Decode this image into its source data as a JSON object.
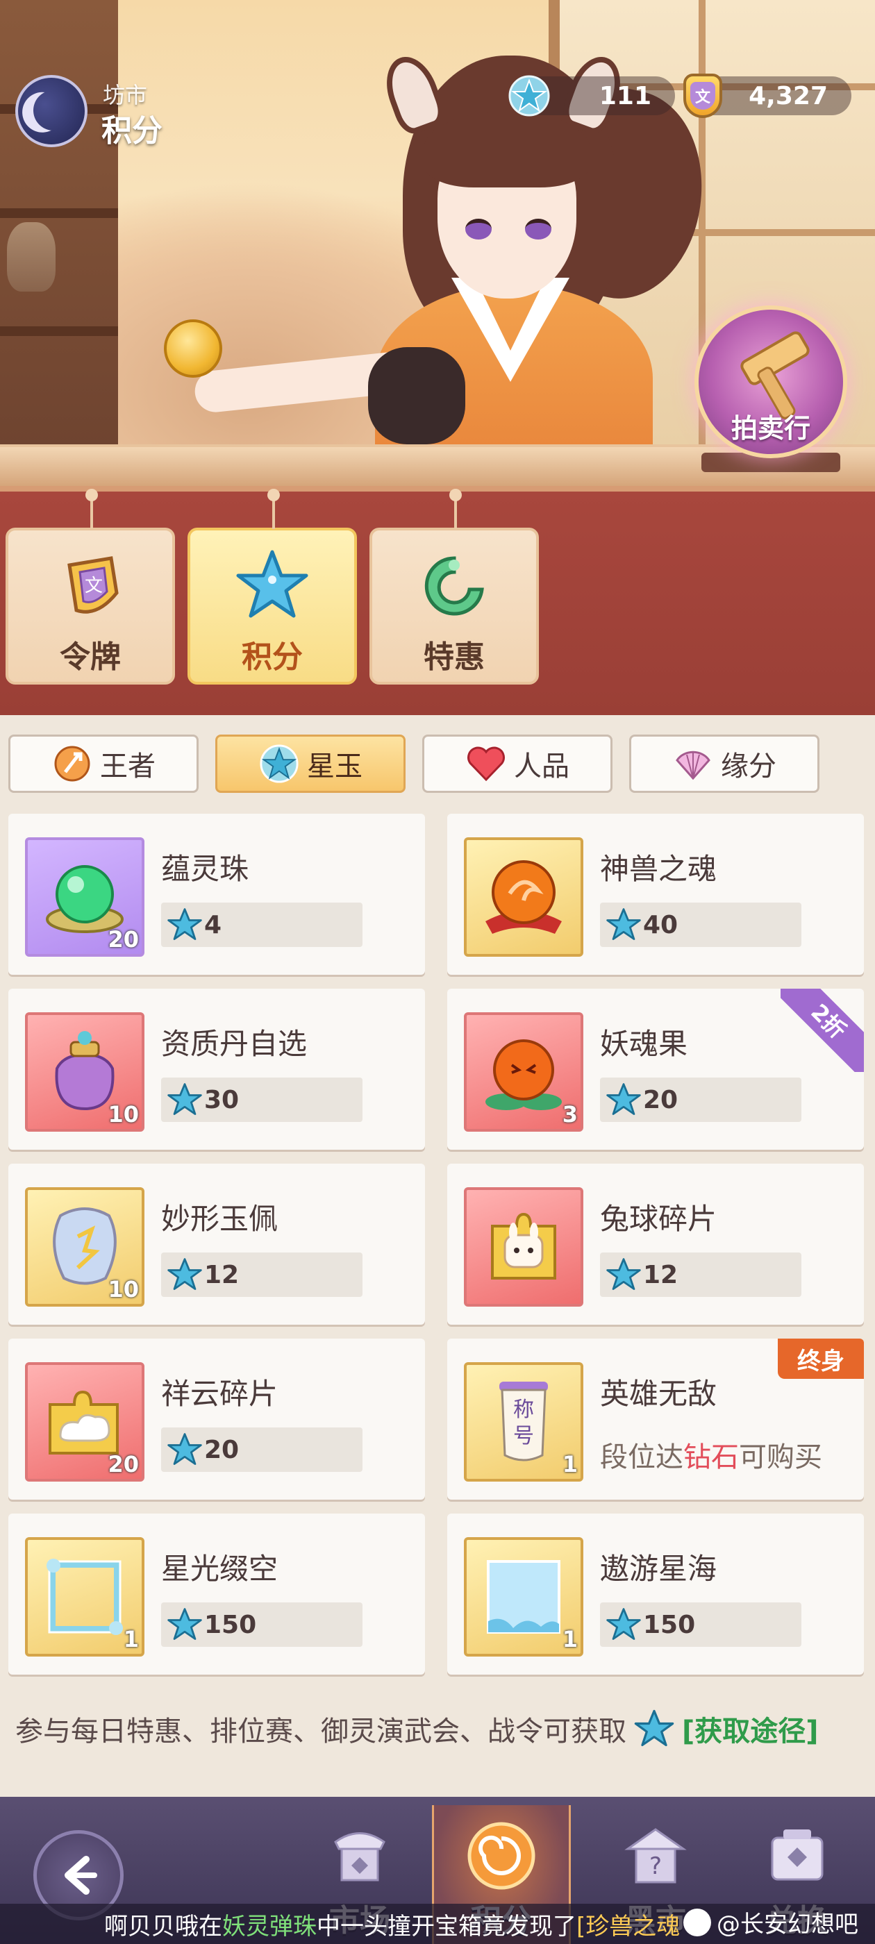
{
  "header": {
    "breadcrumb": "坊市",
    "title": "积分",
    "currencies": [
      {
        "icon": "star-jade-icon",
        "value": "111"
      },
      {
        "icon": "token-coin-icon",
        "value": "4,327"
      }
    ],
    "auction_label": "拍卖行"
  },
  "categories": [
    {
      "label": "令牌",
      "icon": "token-icon",
      "active": false
    },
    {
      "label": "积分",
      "icon": "star-icon",
      "active": true
    },
    {
      "label": "特惠",
      "icon": "jade-dragon-icon",
      "active": false
    }
  ],
  "subtabs": [
    {
      "label": "王者",
      "icon": "sword-icon",
      "active": false
    },
    {
      "label": "星玉",
      "icon": "star-jade-icon",
      "active": true
    },
    {
      "label": "人品",
      "icon": "heart-icon",
      "active": false
    },
    {
      "label": "缘分",
      "icon": "shell-icon",
      "active": false
    }
  ],
  "items": [
    {
      "name": "蕴灵珠",
      "price": "4",
      "qty": "20",
      "frame": "purple"
    },
    {
      "name": "神兽之魂",
      "price": "40",
      "qty": "",
      "frame": "gold"
    },
    {
      "name": "资质丹自选",
      "price": "30",
      "qty": "10",
      "frame": "red"
    },
    {
      "name": "妖魂果",
      "price": "20",
      "qty": "3",
      "frame": "red",
      "ribbon": "2折"
    },
    {
      "name": "妙形玉佩",
      "price": "12",
      "qty": "10",
      "frame": "gold"
    },
    {
      "name": "兔球碎片",
      "price": "12",
      "qty": "",
      "frame": "red"
    },
    {
      "name": "祥云碎片",
      "price": "20",
      "qty": "20",
      "frame": "red"
    },
    {
      "name": "英雄无敌",
      "qty": "1",
      "frame": "gold",
      "tag": "终身",
      "note_pre": "段位达",
      "note_hl": "钻石",
      "note_post": "可购买"
    },
    {
      "name": "星光缀空",
      "price": "150",
      "qty": "1",
      "frame": "gold"
    },
    {
      "name": "遨游星海",
      "price": "150",
      "qty": "1",
      "frame": "gold"
    }
  ],
  "item_icons": {
    "title_scroll_text_1": "称",
    "title_scroll_text_2": "号"
  },
  "footer": {
    "info_text": "参与每日特惠、排位赛、御灵演武会、战令可获取",
    "link": "[获取途径]"
  },
  "nav": {
    "items": [
      {
        "label": "市场",
        "icon": "market-icon",
        "active": false
      },
      {
        "label": "积分",
        "icon": "points-swirl-icon",
        "active": true
      },
      {
        "label": "黑市",
        "icon": "black-market-icon",
        "active": false
      },
      {
        "label": "兑换",
        "icon": "exchange-icon",
        "active": false
      }
    ]
  },
  "ticker": {
    "user": "啊贝贝哦在",
    "place": "妖灵弹珠",
    "mid": "中一头撞开宝箱竟发现了",
    "prize": "[珍兽之魂"
  },
  "watermark": "@长安幻想吧",
  "colors": {
    "accent": "#f7c66c",
    "band": "#a8473d",
    "link_green": "#2f9b4a",
    "highlight_red": "#e24d5a",
    "ribbon_purple": "#a06bd0",
    "tag_orange": "#e6672a"
  }
}
